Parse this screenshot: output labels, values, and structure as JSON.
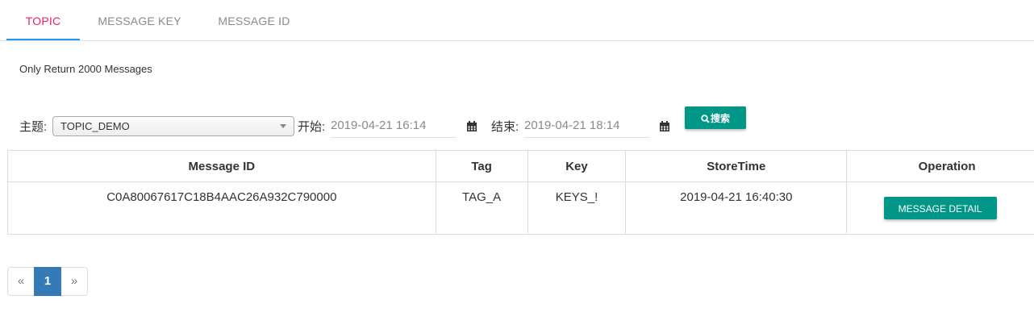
{
  "tabs": [
    {
      "label": "TOPIC",
      "active": true
    },
    {
      "label": "MESSAGE KEY",
      "active": false
    },
    {
      "label": "MESSAGE ID",
      "active": false
    }
  ],
  "notice": "Only Return 2000 Messages",
  "search": {
    "topic_label": "主题:",
    "topic_value": "TOPIC_DEMO",
    "begin_label": "开始:",
    "begin_value": "2019-04-21 16:14",
    "end_label": "结束:",
    "end_value": "2019-04-21 18:14",
    "search_button": "搜索"
  },
  "table": {
    "headers": [
      "Message ID",
      "Tag",
      "Key",
      "StoreTime",
      "Operation"
    ],
    "rows": [
      {
        "message_id": "C0A80067617C18B4AAC26A932C790000",
        "tag": "TAG_A",
        "key": "KEYS_!",
        "store_time": "2019-04-21 16:40:30",
        "operation": "MESSAGE DETAIL"
      }
    ]
  },
  "pagination": {
    "prev": "«",
    "current": "1",
    "next": "»"
  },
  "colors": {
    "active_tab_text": "#e91e63",
    "tab_indicator": "#2196f3",
    "button": "#009688",
    "page_active": "#337ab7"
  },
  "icons": {
    "calendar": "calendar-icon",
    "search": "search-icon",
    "dropdown": "chevron-down-icon"
  }
}
